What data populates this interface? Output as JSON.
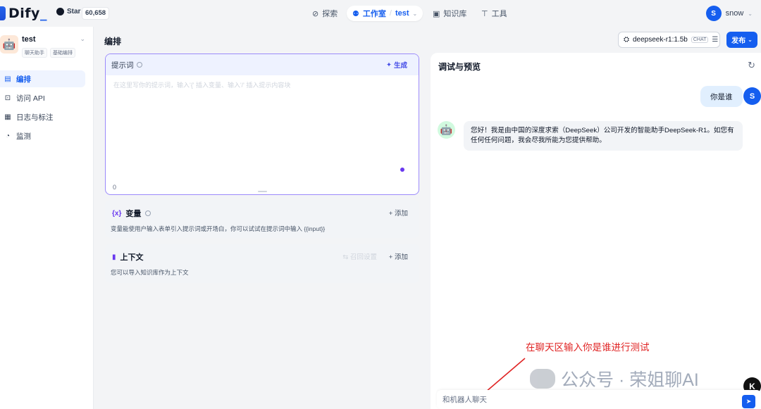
{
  "brand": {
    "name": "Dify",
    "underscore": "_"
  },
  "github": {
    "star_label": "Star",
    "count": "60,658"
  },
  "nav": {
    "explore": "探索",
    "studio": "工作室",
    "separator": "/",
    "app": "test",
    "knowledge": "知识库",
    "tools": "工具"
  },
  "user": {
    "initial": "S",
    "name": "snow"
  },
  "app": {
    "name": "test",
    "tags": [
      "聊天助手",
      "基础编排"
    ]
  },
  "sidebar": {
    "items": [
      {
        "label": "编排",
        "icon": "layout-icon",
        "active": true
      },
      {
        "label": "访问 API",
        "icon": "terminal-icon",
        "active": false
      },
      {
        "label": "日志与标注",
        "icon": "file-list-icon",
        "active": false
      },
      {
        "label": "监测",
        "icon": "dashboard-icon",
        "active": false
      }
    ]
  },
  "main": {
    "title": "编排"
  },
  "model": {
    "name": "deepseek-r1:1.5b",
    "mode_tag": "CHAT"
  },
  "publish": {
    "label": "发布"
  },
  "prompt": {
    "label": "提示词",
    "generate": "生成",
    "placeholder": "在这里写你的提示词，输入'{' 插入变量、输入'/' 插入提示内容块",
    "count": "0"
  },
  "variables": {
    "title": "变量",
    "add": "添加",
    "desc": "变量能使用户输入表单引入提示词或开场白，你可以试试在提示词中输入 {{input}}"
  },
  "context": {
    "title": "上下文",
    "reset": "召回设置",
    "add": "添加",
    "desc": "您可以导入知识库作为上下文"
  },
  "debug": {
    "title": "调试与预览",
    "user_message": "你是谁",
    "user_initial": "S",
    "bot_message": "您好！我是由中国的深度求索（DeepSeek）公司开发的智能助手DeepSeek-R1。如您有任何任何问题，我会尽我所能为您提供帮助。"
  },
  "annotation": "在聊天区输入你是谁进行测试",
  "watermark": {
    "text": "公众号 · 荣姐聊AI",
    "badge": "K"
  },
  "chat_input": {
    "value": "和机器人聊天"
  },
  "colors": {
    "accent": "#155eef",
    "prompt_border": "#9b8afb",
    "annotation": "#e02424"
  }
}
